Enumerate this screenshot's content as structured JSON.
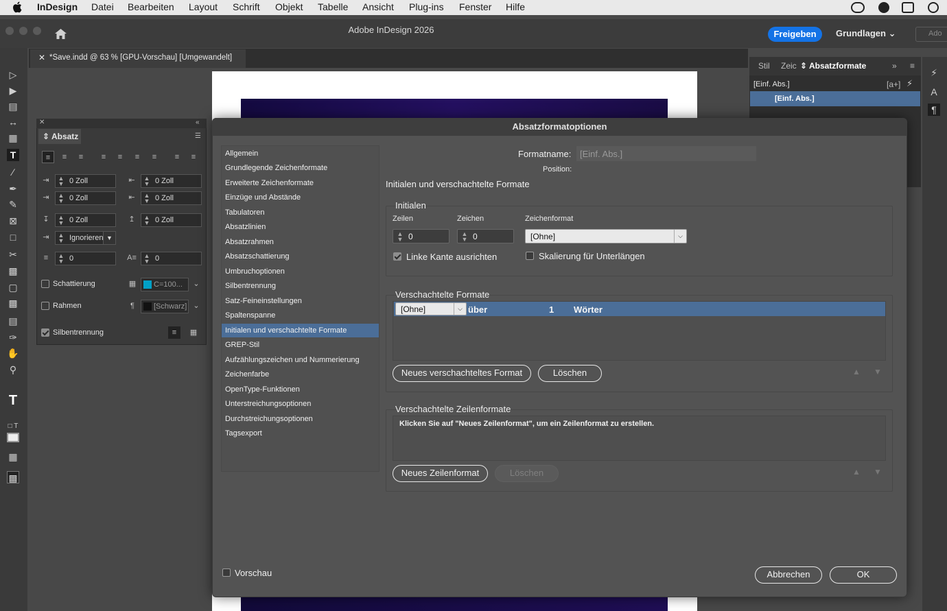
{
  "menubar": {
    "app": "InDesign",
    "items": [
      "Datei",
      "Bearbeiten",
      "Layout",
      "Schrift",
      "Objekt",
      "Tabelle",
      "Ansicht",
      "Plug-ins",
      "Fenster",
      "Hilfe"
    ]
  },
  "window": {
    "title": "Adobe InDesign 2026",
    "share": "Freigeben",
    "workspace": "Grundlagen",
    "search": "Ado"
  },
  "doc_tab": "*Save.indd @ 63 % [GPU-Vorschau] [Umgewandelt]",
  "right_panel": {
    "tabs": [
      "Stil",
      "Zeic",
      "Absatzformate"
    ],
    "items": [
      "[Einf. Abs.]",
      "[Einf. Abs.]"
    ],
    "new_btn": "[a+]"
  },
  "absatz_panel": {
    "title": "Absatz",
    "left_indent": "0 Zoll",
    "right_indent": "0 Zoll",
    "first_indent": "0 Zoll",
    "last_indent": "0 Zoll",
    "space_before": "0 Zoll",
    "space_after": "0 Zoll",
    "align_to_grid": "Ignorieren",
    "dropcap_lines": "0",
    "dropcap_chars": "0",
    "shading_label": "Schattierung",
    "shading_color": "C=100...",
    "border_label": "Rahmen",
    "border_color": "[Schwarz]",
    "hyphenation_label": "Silbentrennung"
  },
  "dialog": {
    "title": "Absatzformatoptionen",
    "nav_items": [
      "Allgemein",
      "Grundlegende Zeichenformate",
      "Erweiterte Zeichenformate",
      "Einzüge und Abstände",
      "Tabulatoren",
      "Absatzlinien",
      "Absatzrahmen",
      "Absatzschattierung",
      "Umbruchoptionen",
      "Silbentrennung",
      "Satz-Feineinstellungen",
      "Spaltenspanne",
      "Initialen und verschachtelte Formate",
      "GREP-Stil",
      "Aufzählungszeichen und Nummerierung",
      "Zeichenfarbe",
      "OpenType-Funktionen",
      "Unterstreichungsoptionen",
      "Durchstreichungsoptionen",
      "Tagsexport"
    ],
    "selected_nav": "Initialen und verschachtelte Formate",
    "formatname_label": "Formatname:",
    "formatname_value": "[Einf. Abs.]",
    "position_label": "Position:",
    "section_title": "Initialen und verschachtelte Formate",
    "initials": {
      "title": "Initialen",
      "lines_label": "Zeilen",
      "lines_value": "0",
      "chars_label": "Zeichen",
      "chars_value": "0",
      "charstyle_label": "Zeichenformat",
      "charstyle_value": "[Ohne]",
      "align_left_label": "Linke Kante ausrichten",
      "align_left_checked": true,
      "scale_label": "Skalierung für Unterlängen",
      "scale_checked": false
    },
    "nested": {
      "title": "Verschachtelte Formate",
      "row": {
        "style": "[Ohne]",
        "through": "über",
        "count": "1",
        "unit": "Wörter"
      },
      "new_btn": "Neues verschachteltes Format",
      "delete_btn": "Löschen"
    },
    "nested_lines": {
      "title": "Verschachtelte Zeilenformate",
      "hint": "Klicken Sie auf \"Neues Zeilenformat\", um ein Zeilenformat zu erstellen.",
      "new_btn": "Neues Zeilenformat",
      "delete_btn": "Löschen"
    },
    "preview_label": "Vorschau",
    "preview_checked": false,
    "cancel": "Abbrechen",
    "ok": "OK"
  }
}
